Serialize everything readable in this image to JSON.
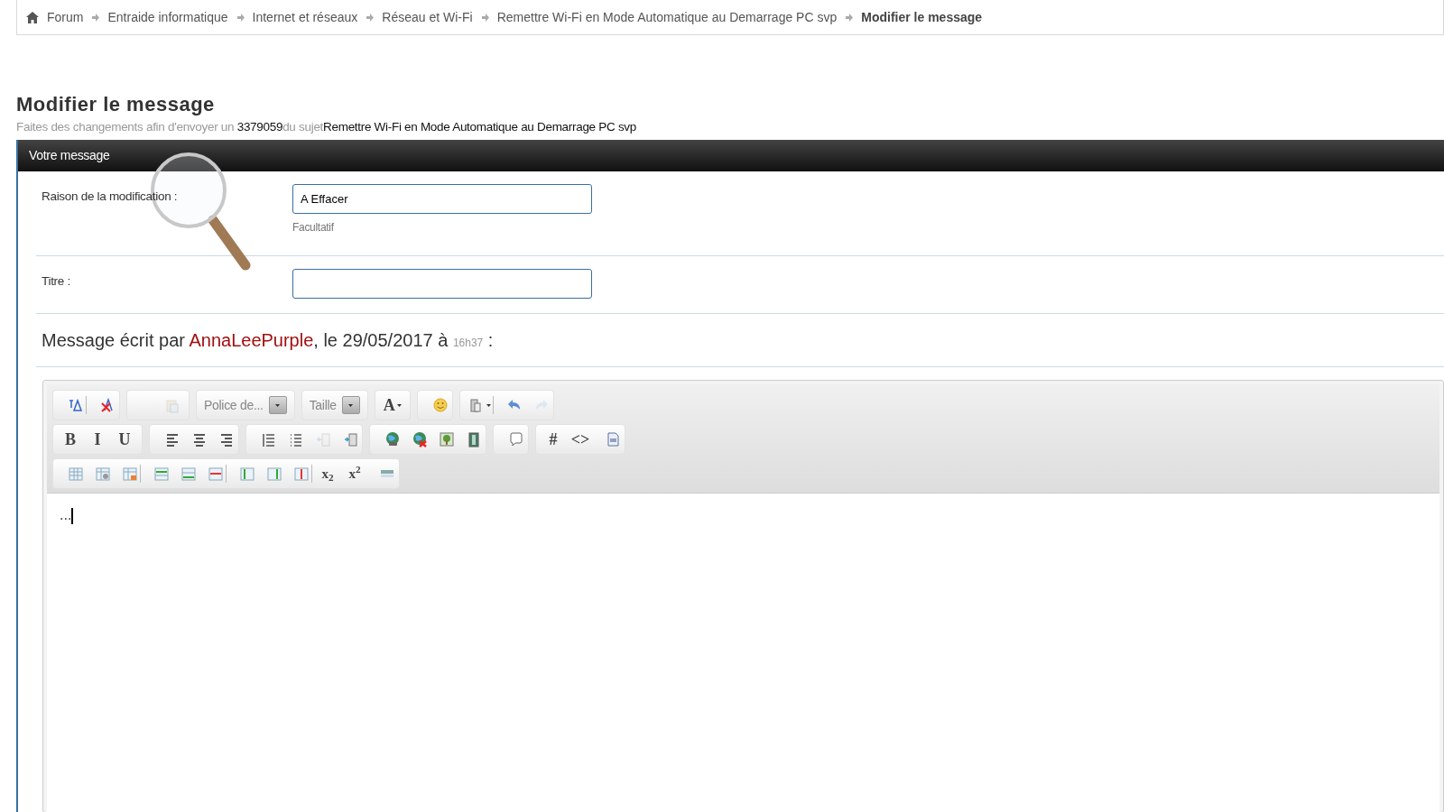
{
  "breadcrumb": [
    {
      "label": "Forum",
      "current": false
    },
    {
      "label": "Entraide informatique",
      "current": false
    },
    {
      "label": "Internet et réseaux",
      "current": false
    },
    {
      "label": "Réseau et Wi-Fi",
      "current": false
    },
    {
      "label": "Remettre Wi-Fi en Mode Automatique au Demarrage PC svp",
      "current": false
    },
    {
      "label": "Modifier le message",
      "current": true
    }
  ],
  "page_title": "Modifier le message",
  "subtitle": [
    {
      "text": "Faites des changements afin d'envoyer un ",
      "strong": false
    },
    {
      "text": "3379059",
      "strong": true
    },
    {
      "text": "du sujet",
      "strong": false
    },
    {
      "text": "Remettre Wi-Fi en Mode Automatique au Demarrage PC svp",
      "strong": true
    }
  ],
  "panel_title": "Votre message",
  "fields": [
    {
      "label": "Raison de la modification :",
      "value": "A Effacer",
      "hint": "Facultatif"
    },
    {
      "label": "Titre :"
    }
  ],
  "message_info": [
    {
      "kind": "text",
      "text": "Message écrit par "
    },
    {
      "kind": "author",
      "text": "AnnaLeePurple"
    },
    {
      "kind": "text",
      "text": ", le 29/05/2017 à "
    },
    {
      "kind": "time",
      "text": "16h37"
    },
    {
      "kind": "text",
      "text": " :"
    }
  ],
  "toolbar_rows": [
    [
      [
        {
          "kind": "icon"
        },
        {
          "kind": "separator"
        },
        {
          "kind": "icon"
        }
      ],
      [
        {
          "kind": "icon",
          "disabled": true
        }
      ],
      [
        {
          "kind": "dropdown",
          "label": "Police de..."
        }
      ],
      [
        {
          "kind": "dropdown",
          "label": "Taille"
        }
      ],
      [
        {
          "kind": "glyph",
          "text": "A",
          "caret": true
        }
      ],
      [
        {
          "kind": "icon"
        }
      ],
      [
        {
          "kind": "icon",
          "caret": true
        },
        {
          "kind": "separator"
        },
        {
          "kind": "icon"
        },
        {
          "kind": "icon",
          "disabled": true
        }
      ]
    ],
    [
      [
        {
          "kind": "glyph",
          "text": "B"
        },
        {
          "kind": "glyph",
          "text": "I"
        },
        {
          "kind": "glyph",
          "text": "U"
        }
      ],
      [
        {
          "kind": "icon"
        },
        {
          "kind": "icon"
        },
        {
          "kind": "icon"
        }
      ],
      [
        {
          "kind": "icon"
        },
        {
          "kind": "icon"
        },
        {
          "kind": "icon",
          "disabled": true
        },
        {
          "kind": "icon"
        }
      ],
      [
        {
          "kind": "icon"
        },
        {
          "kind": "icon"
        },
        {
          "kind": "icon"
        },
        {
          "kind": "icon"
        }
      ],
      [
        {
          "kind": "icon"
        }
      ],
      [
        {
          "kind": "glyph",
          "text": "#"
        },
        {
          "kind": "glyph",
          "text": "<>"
        },
        {
          "kind": "icon"
        }
      ]
    ],
    [
      [
        {
          "kind": "icon"
        },
        {
          "kind": "icon"
        },
        {
          "kind": "icon"
        },
        {
          "kind": "separator"
        },
        {
          "kind": "icon"
        },
        {
          "kind": "icon"
        },
        {
          "kind": "icon"
        },
        {
          "kind": "separator"
        },
        {
          "kind": "icon"
        },
        {
          "kind": "icon"
        },
        {
          "kind": "icon"
        },
        {
          "kind": "separator"
        },
        {
          "kind": "glyph",
          "text": "x$_{2}$"
        },
        {
          "kind": "glyph",
          "text": "x$^{2}$"
        },
        {
          "kind": "icon"
        }
      ]
    ]
  ],
  "editor_text": "..."
}
